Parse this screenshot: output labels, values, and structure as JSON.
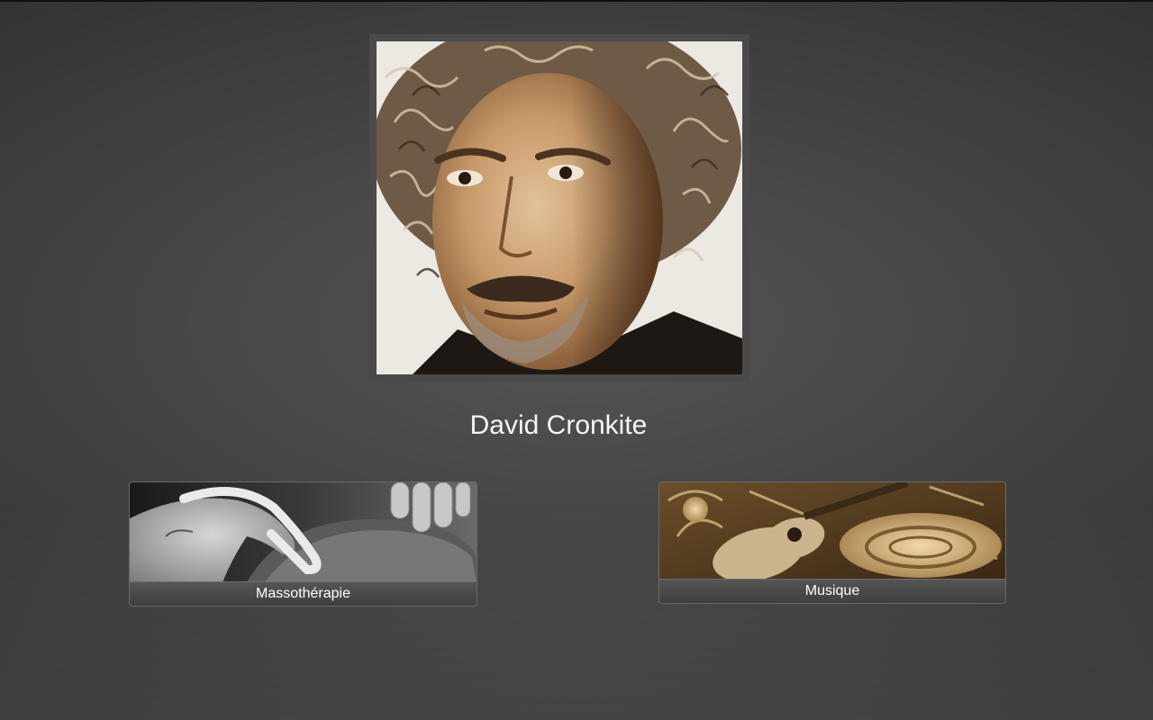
{
  "profile": {
    "name": "David Cronkite"
  },
  "cards": [
    {
      "label": "Massothérapie",
      "icon": "massage-hands-image"
    },
    {
      "label": "Musique",
      "icon": "instruments-image"
    }
  ],
  "colors": {
    "background": "#3e3e3e",
    "frame": "#4a4a4a",
    "text": "#f5f5f5"
  }
}
